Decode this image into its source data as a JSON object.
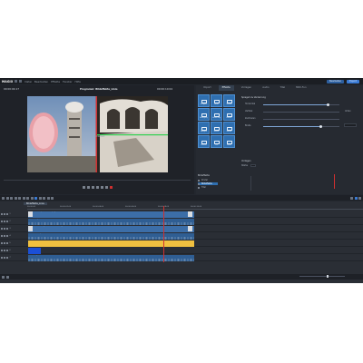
{
  "app": {
    "logo": "MAGIX",
    "menu": [
      "Datei",
      "Bearbeiten",
      "Effekte",
      "Fenster",
      "Hilfe"
    ],
    "top_buttons": [
      "Bearbeiten",
      "Export"
    ]
  },
  "monitor": {
    "timecode_left": "00:00:04:17",
    "timecode_right": "00:00:10:04",
    "project_title": "Programm: Bildeffekte_Linie",
    "sub_label": "Bildeffekt"
  },
  "right_panel": {
    "tabs": [
      "Import",
      "Effekte",
      "Vorlagen",
      "Audio",
      "Titel",
      "MIDI-Fun"
    ],
    "active_tab": "Effekte",
    "fx_tiles": [
      "Helligkeit",
      "Farbe",
      "Schärfe",
      "Bewegung",
      "Verzerrung",
      "Stabilis.",
      "Spiegeln",
      "Schnitt",
      "Blende",
      "Kamera",
      "Stil",
      "Maske"
    ],
    "settings_title": "Spiegeln & Verzerrung",
    "settings": [
      {
        "label": "Horizontal",
        "value": "",
        "fill": 0.85
      },
      {
        "label": "Vertikal",
        "value": "Unten",
        "fill": 0.0
      },
      {
        "label": "Zentrieren",
        "value": "",
        "fill": 0.0
      },
      {
        "label": "Breite",
        "value": "",
        "fill": 0.75
      }
    ],
    "presets_title": "Vorlagen",
    "preset_label": "Stärke",
    "preset_value": "",
    "project_head": "Bildeffekte",
    "project_rows": [
      "Kinder",
      "Bildeffekte",
      "Titel"
    ]
  },
  "timeline": {
    "project_tab": "Bildeffekte_Linie",
    "ruler_labels": [
      "00:00:00",
      "00:00:02:00",
      "00:00:04:00",
      "00:00:06:00",
      "00:00:08:00",
      "00:00:10:00"
    ],
    "tracks": [
      {
        "n": "1",
        "label": "Kinder.mp4  Bildeffekt: Spiegeln, Horizontal",
        "kind": "vid"
      },
      {
        "n": "2",
        "label": "Kinder.mp4  Audio",
        "kind": "aud"
      },
      {
        "n": "3",
        "label": "Bildeffekte.mp4  Bildeffekt: Verzerrung",
        "kind": "vid"
      },
      {
        "n": "4",
        "label": "Bildeffekte.mp4  Audio",
        "kind": "aud"
      },
      {
        "n": "5",
        "label": "Titel  Bildeffekt: Linie",
        "kind": "yellow"
      },
      {
        "n": "6",
        "label": "Linie",
        "kind": "blue"
      },
      {
        "n": "7",
        "label": "Musik.mp3",
        "kind": "aud"
      }
    ]
  },
  "colors": {
    "accent": "#3a7bd5",
    "playhead": "#d03030",
    "clip_video": "#3c6ea8",
    "clip_yellow": "#f0c040",
    "clip_blue": "#1b4fd6",
    "panel_bg": "#23272e"
  }
}
